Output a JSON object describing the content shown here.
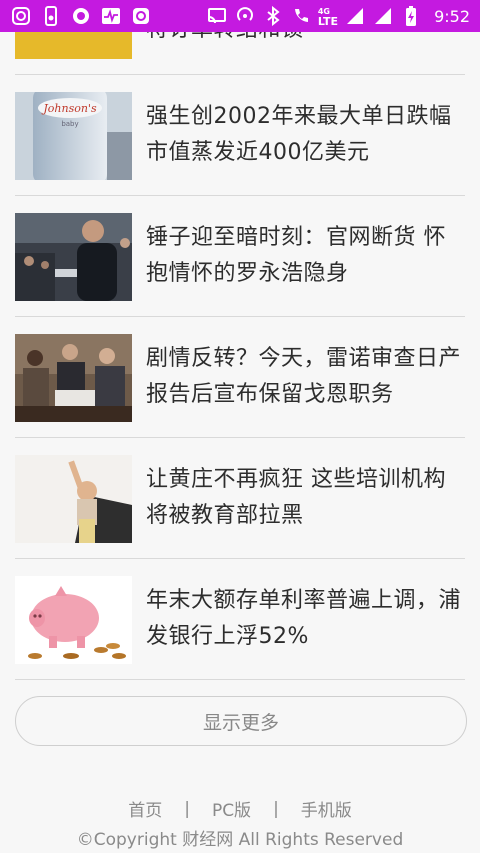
{
  "status_bar": {
    "time": "9:52",
    "network": "LTE",
    "network_small": "4G",
    "icons": [
      "instagram-icon",
      "phone-settings-icon",
      "circle-app-icon",
      "pulse-icon",
      "instagram-icon",
      "cast-icon",
      "hotspot-icon",
      "bluetooth-icon",
      "wifi-calling-icon",
      "signal-icon",
      "signal-icon",
      "battery-charging-icon"
    ],
    "background": "#c41ae0"
  },
  "news": {
    "partial_title": "将订单转结和锁",
    "items": [
      {
        "title": "强生创2002年来最大单日跌幅 市值蒸发近400亿美元",
        "thumb": "johnson-baby-powder-image"
      },
      {
        "title": "锤子迎至暗时刻：官网断货 怀抱情怀的罗永浩隐身",
        "thumb": "presenter-on-stage-image"
      },
      {
        "title": "剧情反转？今天，雷诺审查日产报告后宣布保留戈恩职务",
        "thumb": "business-meeting-image"
      },
      {
        "title": "让黄庄不再疯狂 这些培训机构将被教育部拉黑",
        "thumb": "child-superhero-image"
      },
      {
        "title": "年末大额存单利率普遍上调，浦发银行上浮52%",
        "thumb": "piggy-bank-coins-image"
      }
    ]
  },
  "more_button": {
    "label": "显示更多"
  },
  "footer": {
    "links": [
      "首页",
      "PC版",
      "手机版"
    ],
    "separator": "|",
    "copyright": "©Copyright 财经网 All Rights Reserved"
  }
}
